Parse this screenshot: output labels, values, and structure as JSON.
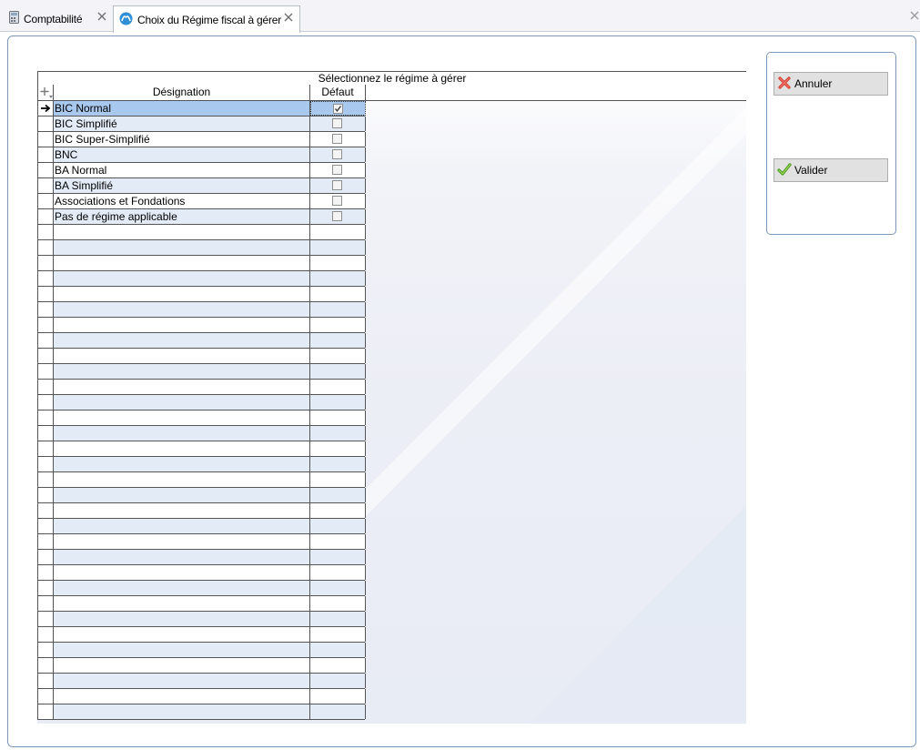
{
  "tabs": [
    {
      "label": "Comptabilité",
      "icon": "calculator-icon",
      "active": false
    },
    {
      "label": "Choix du Régime fiscal à gérer",
      "icon": "app-logo-icon",
      "active": true
    }
  ],
  "grid": {
    "title": "Sélectionnez le régime à gérer",
    "columns": {
      "designation": "Désignation",
      "defaut": "Défaut"
    },
    "rows": [
      {
        "designation": "BIC Normal",
        "defaut": true,
        "selected": true
      },
      {
        "designation": "BIC Simplifié",
        "defaut": false
      },
      {
        "designation": "BIC Super-Simplifié",
        "defaut": false
      },
      {
        "designation": "BNC",
        "defaut": false
      },
      {
        "designation": "BA Normal",
        "defaut": false
      },
      {
        "designation": "BA Simplifié",
        "defaut": false
      },
      {
        "designation": "Associations et Fondations",
        "defaut": false
      },
      {
        "designation": "Pas de régime applicable",
        "defaut": false
      }
    ]
  },
  "buttons": {
    "cancel_label": "Annuler",
    "ok_label": "Valider"
  },
  "colors": {
    "selected_row": "#a9c8ee",
    "alt_row": "#e3ecf6",
    "panel_border": "#7b97ba"
  }
}
